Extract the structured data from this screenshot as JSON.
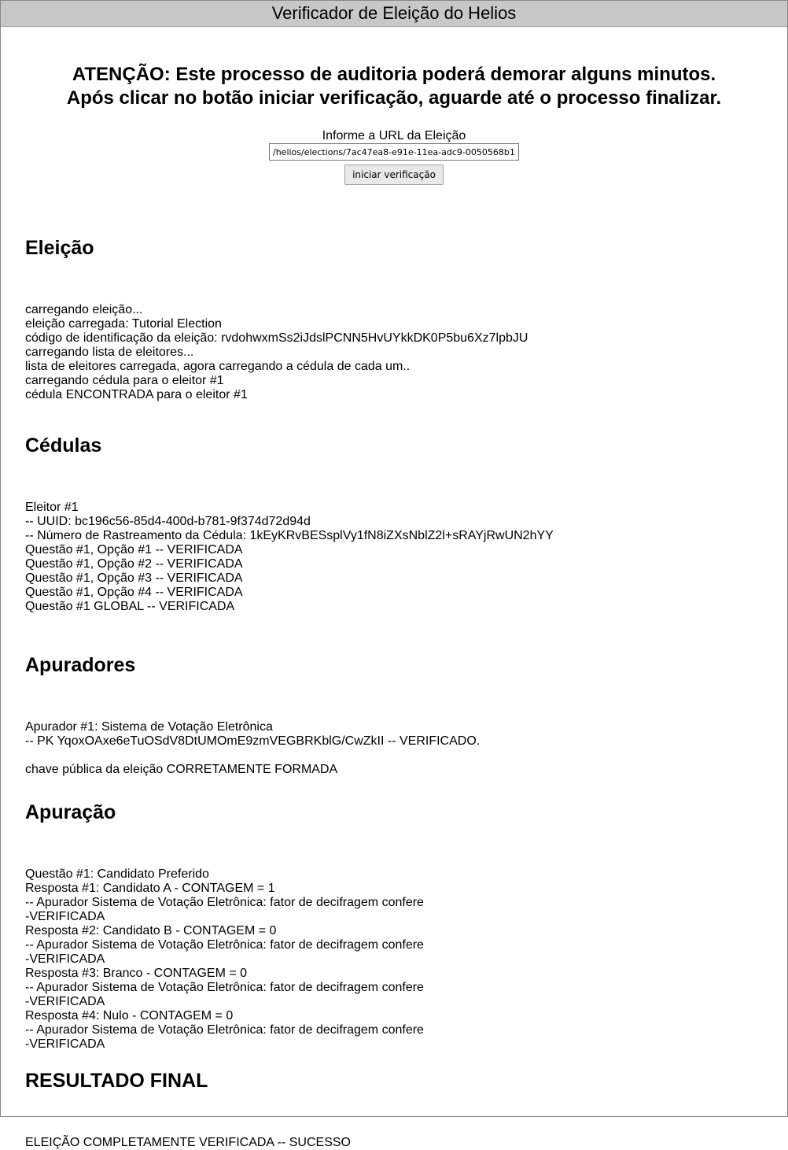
{
  "window": {
    "title": "Verificador de Eleição do Helios"
  },
  "warning": {
    "line1": "ATENÇÃO: Este processo de auditoria poderá demorar alguns minutos.",
    "line2": "Após clicar no botão iniciar verificação, aguarde até o processo finalizar."
  },
  "url_form": {
    "label": "Informe a URL da Eleição",
    "value": "/helios/elections/7ac47ea8-e91e-11ea-adc9-0050568b1",
    "button_label": "iniciar verificação"
  },
  "sections": {
    "eleicao": {
      "title": "Eleição",
      "lines": [
        "carregando eleição...",
        "eleição carregada: Tutorial Election",
        "código de identificação da eleição: rvdohwxmSs2iJdslPCNN5HvUYkkDK0P5bu6Xz7lpbJU",
        "carregando lista de eleitores...",
        "lista de eleitores carregada, agora carregando a cédula de cada um..",
        "carregando cédula para o eleitor #1",
        "cédula ENCONTRADA para o eleitor #1"
      ]
    },
    "cedulas": {
      "title": "Cédulas",
      "lines": [
        "Eleitor #1",
        "-- UUID: bc196c56-85d4-400d-b781-9f374d72d94d",
        "-- Número de Rastreamento da Cédula: 1kEyKRvBESsplVy1fN8iZXsNblZ2l+sRAYjRwUN2hYY",
        "Questão #1, Opção #1 -- VERIFICADA",
        "Questão #1, Opção #2 -- VERIFICADA",
        "Questão #1, Opção #3 -- VERIFICADA",
        "Questão #1, Opção #4 -- VERIFICADA",
        "Questão #1 GLOBAL -- VERIFICADA"
      ]
    },
    "apuradores": {
      "title": "Apuradores",
      "lines": [
        "Apurador #1: Sistema de Votação Eletrônica",
        "-- PK YqoxOAxe6eTuOSdV8DtUMOmE9zmVEGBRKblG/CwZkII -- VERIFICADO.",
        "",
        "chave pública da eleição CORRETAMENTE FORMADA"
      ]
    },
    "apuracao": {
      "title": "Apuração",
      "lines": [
        "Questão #1: Candidato Preferido",
        "Resposta #1: Candidato A - CONTAGEM = 1",
        "-- Apurador Sistema de Votação Eletrônica: fator de decifragem confere",
        "-VERIFICADA",
        "Resposta #2: Candidato B - CONTAGEM = 0",
        "-- Apurador Sistema de Votação Eletrônica: fator de decifragem confere",
        "-VERIFICADA",
        "Resposta #3: Branco - CONTAGEM = 0",
        "-- Apurador Sistema de Votação Eletrônica: fator de decifragem confere",
        "-VERIFICADA",
        "Resposta #4: Nulo - CONTAGEM = 0",
        "-- Apurador Sistema de Votação Eletrônica: fator de decifragem confere",
        "-VERIFICADA"
      ]
    },
    "resultado": {
      "title": "RESULTADO FINAL",
      "lines": [
        "ELEIÇÃO COMPLETAMENTE VERIFICADA -- SUCESSO"
      ]
    }
  }
}
